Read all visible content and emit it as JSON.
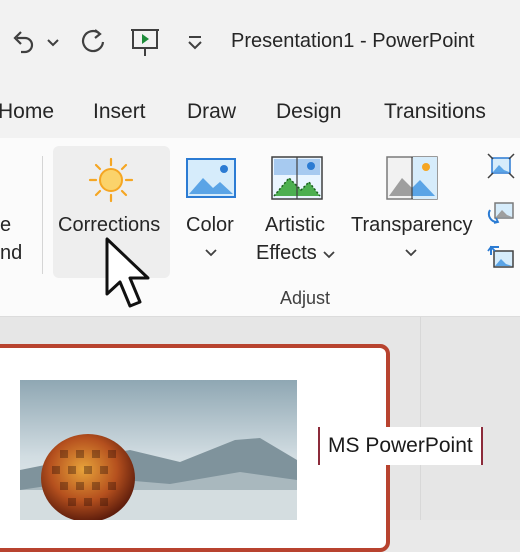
{
  "titlebar": {
    "title": "Presentation1  -  PowerPoint",
    "undo_icon": "undo-icon",
    "undo_dropdown_icon": "chevron-down-icon",
    "redo_icon": "redo-icon",
    "present_icon": "present-from-beginning-icon",
    "customize_icon": "customize-quick-access-icon"
  },
  "tabs": [
    "Home",
    "Insert",
    "Draw",
    "Design",
    "Transitions"
  ],
  "ribbon": {
    "left_cut_label_line1": "e",
    "left_cut_label_line2": "nd",
    "corrections_label": "Corrections",
    "color_label": "Color",
    "artistic_label_line1": "Artistic",
    "artistic_label_line2": "Effects",
    "transparency_label": "Transparency",
    "group_label": "Adjust",
    "icons": {
      "corrections": "sun-icon",
      "color": "picture-color-icon",
      "artistic": "artistic-effects-icon",
      "transparency": "transparency-icon",
      "compress": "compress-pictures-icon",
      "change": "change-picture-icon",
      "reset": "reset-picture-icon"
    }
  },
  "slide": {
    "watermark": "MS PowerPoint"
  },
  "colors": {
    "slide_border": "#b8432f",
    "watermark_border": "#8c2b3a",
    "sun": "#f5a623",
    "accent_blue": "#2b7bd3"
  }
}
